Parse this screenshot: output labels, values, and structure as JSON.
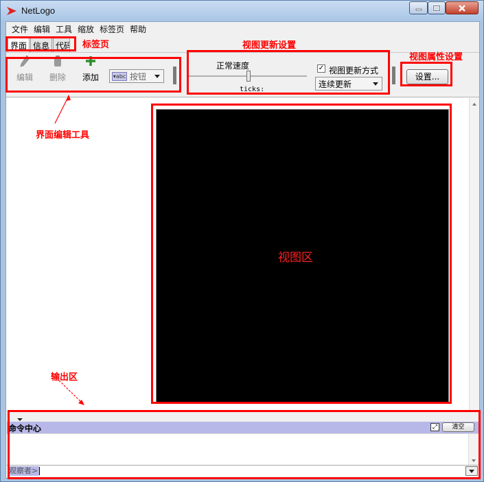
{
  "window": {
    "title": "NetLogo"
  },
  "menu": {
    "items": [
      "文件",
      "编辑",
      "工具",
      "缩放",
      "标签页",
      "帮助"
    ]
  },
  "tabs": {
    "items": [
      "界面",
      "信息",
      "代码"
    ],
    "active": 0
  },
  "toolbar": {
    "edit_label": "编辑",
    "delete_label": "删除",
    "add_label": "添加",
    "widget_type": "按钮",
    "speed_label": "正常速度",
    "ticks_label": "ticks:",
    "view_update_label": "视图更新方式",
    "view_update_checked": true,
    "update_mode": "连续更新",
    "settings_label": "设置..."
  },
  "command_center": {
    "title": "命令中心",
    "clear_label": "清空",
    "observer_label": "观察者>"
  },
  "annotations": {
    "tabs_label": "标签页",
    "view_update_settings": "视图更新设置",
    "view_properties": "视图属性设置",
    "edit_tools": "界面编辑工具",
    "view_area": "视图区",
    "output_area": "输出区"
  },
  "colors": {
    "annotation": "#ff0000",
    "view_background": "#000000",
    "command_header": "#b8b8e8",
    "add_icon": "#2e8b2e"
  }
}
